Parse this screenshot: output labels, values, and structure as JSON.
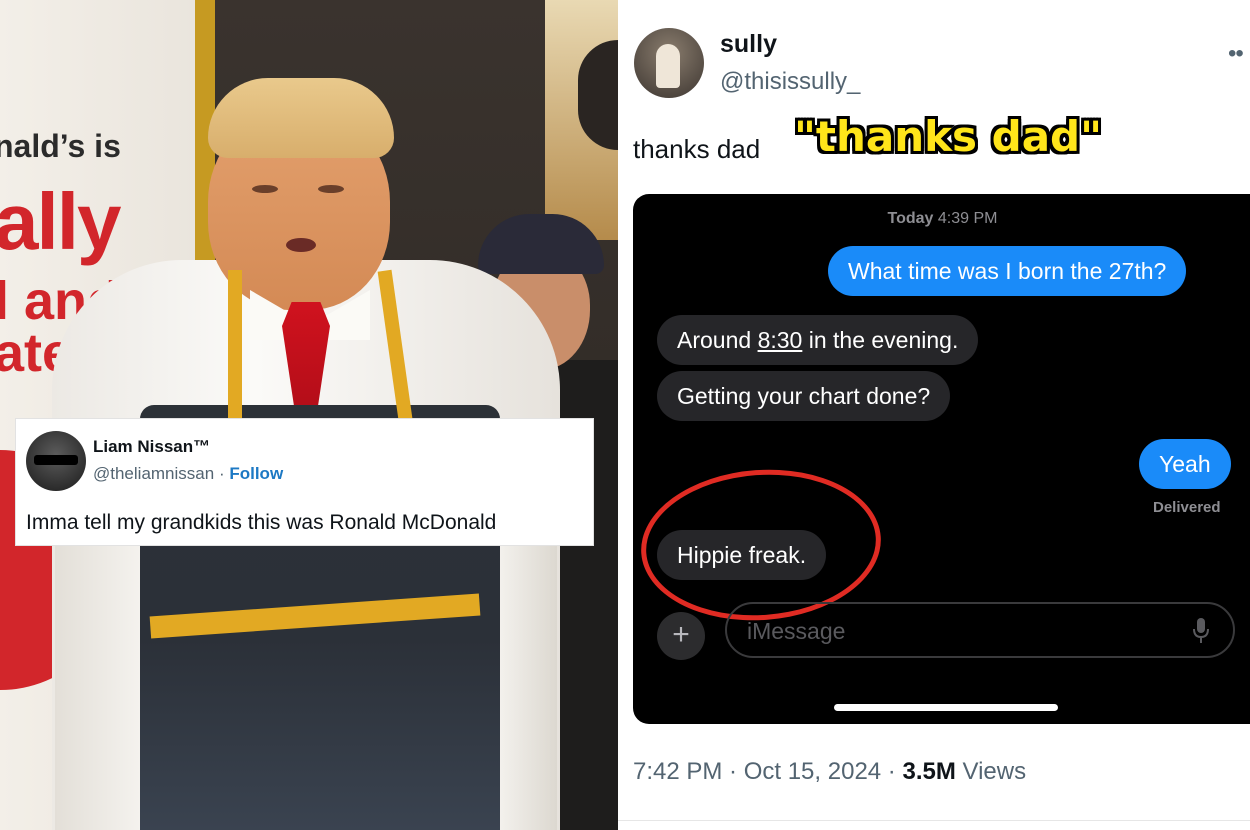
{
  "photo": {
    "sign_lines": [
      "nald’s is",
      "ally",
      "l and",
      "ated"
    ],
    "embedded_tweet": {
      "name": "Liam Nissan™",
      "handle": "@theliamnissan",
      "separator": "·",
      "follow_label": "Follow",
      "text": "Imma tell my grandkids this was Ronald McDonald"
    }
  },
  "tweet": {
    "author_name": "sully",
    "author_handle": "@thisissully_",
    "more_icon": "more-icon",
    "text": "thanks dad",
    "overlay_caption": "\"thanks dad\"",
    "timestamp": "7:42 PM · Oct 15, 2024 · ",
    "views_count": "3.5M",
    "views_label": "Views"
  },
  "imessage": {
    "day": "Today",
    "time": "4:39 PM",
    "messages": [
      {
        "from": "me",
        "text": "What time was I born the 27th?"
      },
      {
        "from": "them",
        "text_before": "Around ",
        "text_link": "8:30",
        "text_after": " in the evening."
      },
      {
        "from": "them",
        "text": "Getting your chart done?"
      },
      {
        "from": "me",
        "text": "Yeah"
      },
      {
        "from": "them",
        "text": "Hippie freak."
      }
    ],
    "delivered_label": "Delivered",
    "input_placeholder": "iMessage",
    "plus_label": "+"
  },
  "colors": {
    "imessage_blue": "#1a8bf9",
    "imessage_gray": "#262629",
    "caption_yellow": "#ffe51a",
    "annotation_red": "#e02b23",
    "follow_blue": "#1d79c4"
  }
}
